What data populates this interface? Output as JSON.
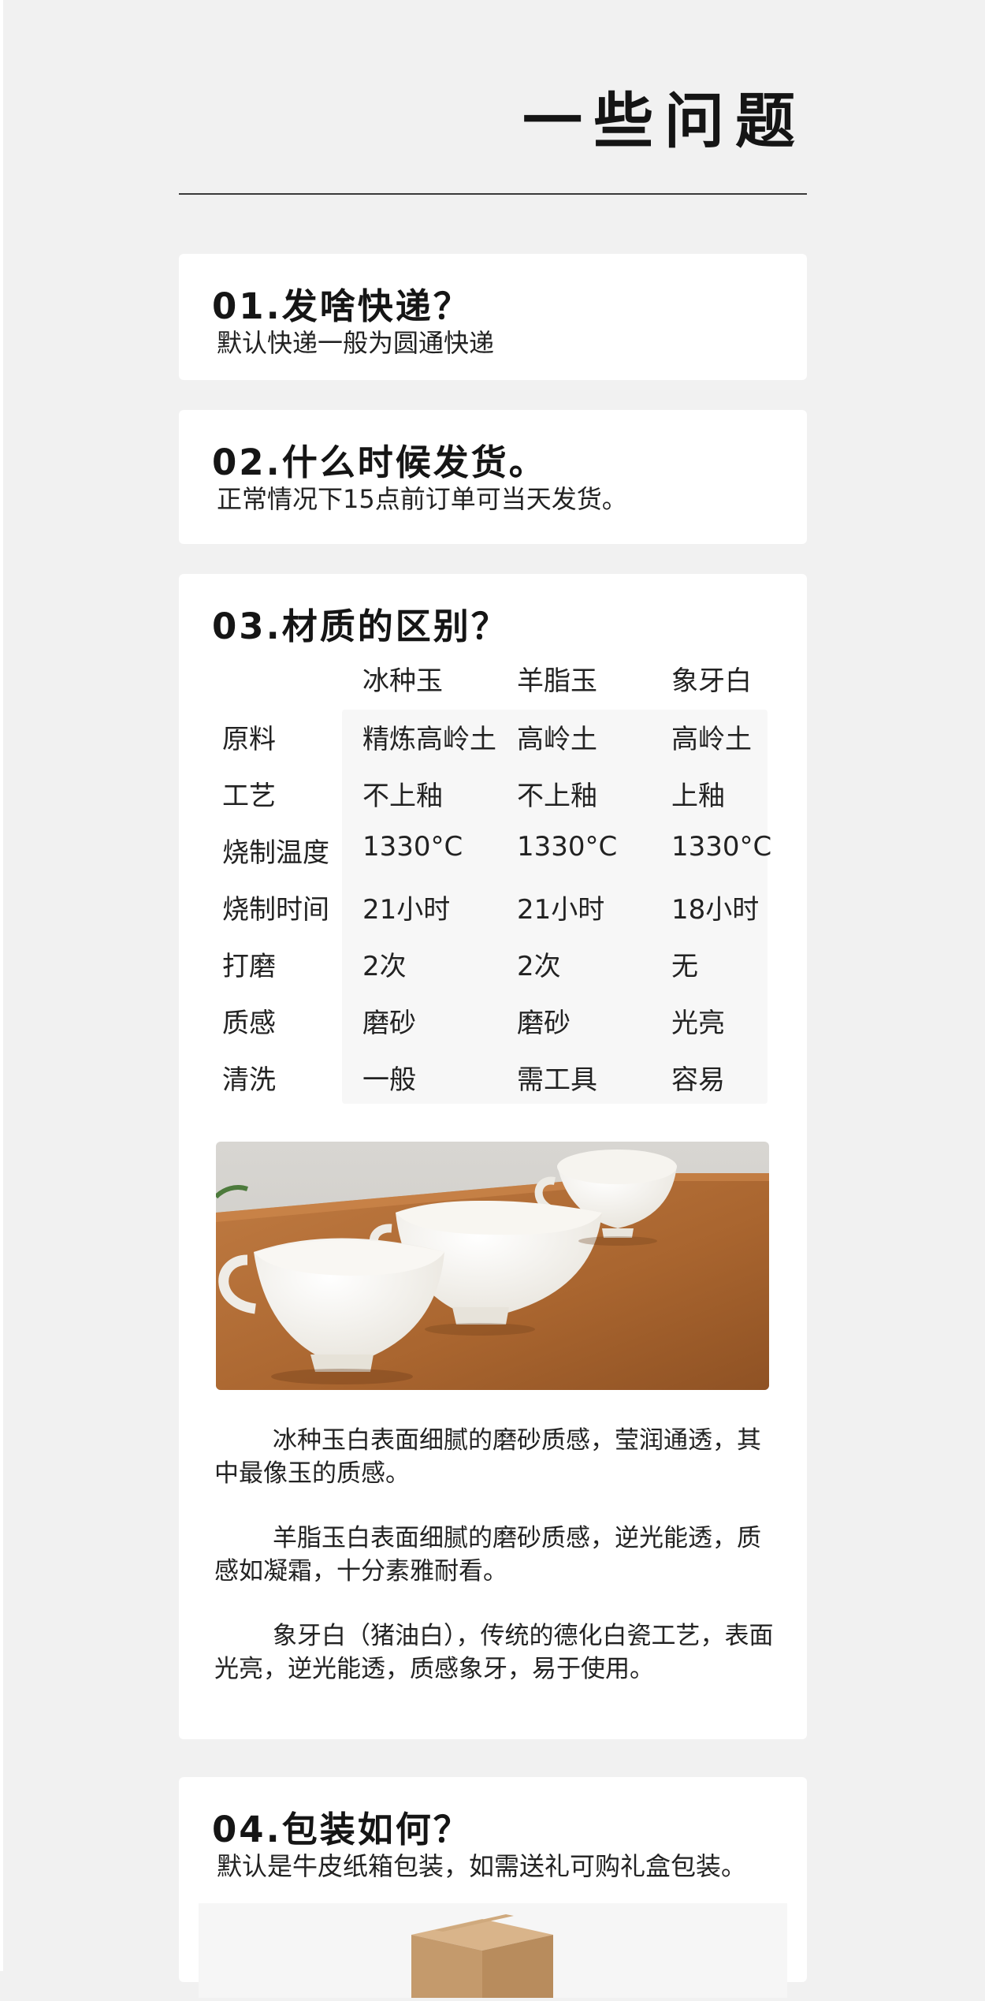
{
  "page": {
    "title": "一些问题"
  },
  "faq": [
    {
      "question": "01.发啥快递？",
      "answer": "默认快递一般为圆通快递"
    },
    {
      "question": "02.什么时候发货。",
      "answer": "正常情况下15点前订单可当天发货。"
    },
    {
      "question": "03.材质的区别？"
    },
    {
      "question": "04.包装如何？",
      "answer": "默认是牛皮纸箱包装，如需送礼可购礼盒包装。"
    }
  ],
  "material_table": {
    "columns": [
      "冰种玉",
      "羊脂玉",
      "象牙白"
    ],
    "rows": [
      [
        "原料",
        "精炼高岭土",
        "高岭土",
        "高岭土"
      ],
      [
        "工艺",
        "不上釉",
        "不上釉",
        "上釉"
      ],
      [
        "烧制温度",
        "1330°C",
        "1330°C",
        "1330°C"
      ],
      [
        "烧制时间",
        "21小时",
        "21小时",
        "18小时"
      ],
      [
        "打磨",
        "2次",
        "2次",
        "无"
      ],
      [
        "质感",
        "磨砂",
        "磨砂",
        "光亮"
      ],
      [
        "清洗",
        "一般",
        "需工具",
        "容易"
      ]
    ]
  },
  "material_descriptions": [
    "冰种玉白表面细腻的磨砂质感，莹润通透，其中最像玉的质感。",
    "羊脂玉白表面细腻的磨砂质感，逆光能透，质感如凝霜，十分素雅耐看。",
    "象牙白（猪油白），传统的德化白瓷工艺，表面光亮，逆光能透，质感象牙，易于使用。"
  ],
  "colors": {
    "page_background": "#f1f1f1",
    "card_background": "#ffffff",
    "table_shade": "#f7f7f7",
    "text": "#1b1b1b",
    "wood": "#b5723c"
  }
}
